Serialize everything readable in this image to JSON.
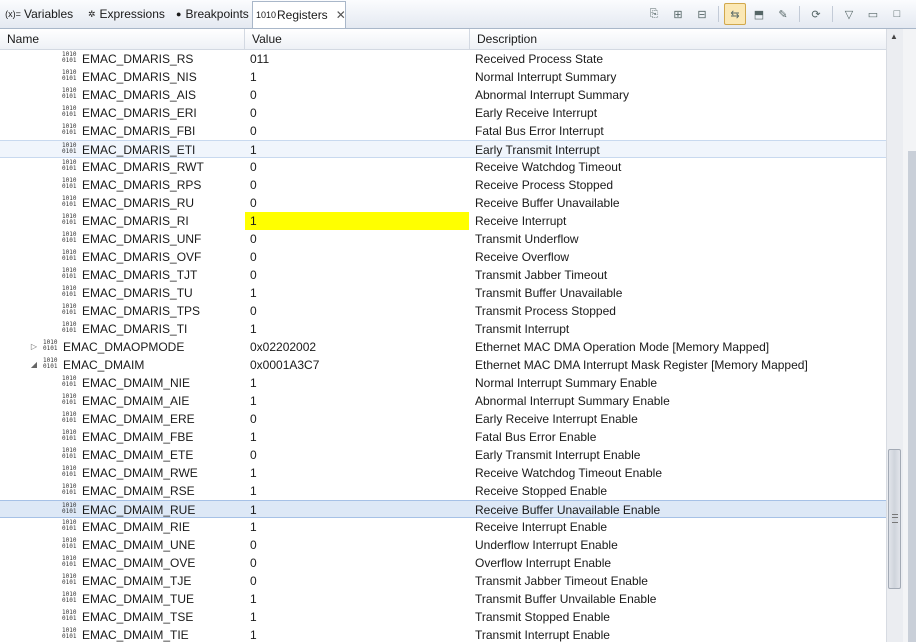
{
  "tabs": [
    {
      "label": "Variables",
      "icon": "variables-icon",
      "glyph": "(x)="
    },
    {
      "label": "Expressions",
      "icon": "expressions-icon",
      "glyph": "✲"
    },
    {
      "label": "Breakpoints",
      "icon": "breakpoints-icon",
      "glyph": "●"
    },
    {
      "label": "Registers",
      "icon": "registers-icon",
      "glyph": "1010",
      "close": "✕"
    }
  ],
  "toolbar": [
    {
      "name": "toolbar-import-icon",
      "glyph": "⎘"
    },
    {
      "name": "toolbar-expand-all-icon",
      "glyph": "⊞"
    },
    {
      "name": "toolbar-collapse-all-icon",
      "glyph": "⊟"
    },
    {
      "name": "toolbar-link-icon",
      "glyph": "⇆",
      "on": true
    },
    {
      "name": "toolbar-new-group-icon",
      "glyph": "⬒"
    },
    {
      "name": "toolbar-edit-group-icon",
      "glyph": "✎"
    },
    {
      "name": "toolbar-refresh-icon",
      "glyph": "⟳"
    },
    {
      "name": "view-menu-icon",
      "glyph": "▽"
    },
    {
      "name": "minimize-icon",
      "glyph": "▭"
    },
    {
      "name": "maximize-icon",
      "glyph": "□"
    }
  ],
  "columns": {
    "name": "Name",
    "value": "Value",
    "description": "Description"
  },
  "rows": [
    {
      "name": "EMAC_DMARIS_RS",
      "value": "011",
      "description": "Received Process State",
      "level": 2
    },
    {
      "name": "EMAC_DMARIS_NIS",
      "value": "1",
      "description": "Normal Interrupt Summary",
      "level": 2
    },
    {
      "name": "EMAC_DMARIS_AIS",
      "value": "0",
      "description": "Abnormal Interrupt Summary",
      "level": 2
    },
    {
      "name": "EMAC_DMARIS_ERI",
      "value": "0",
      "description": "Early Receive Interrupt",
      "level": 2
    },
    {
      "name": "EMAC_DMARIS_FBI",
      "value": "0",
      "description": "Fatal Bus Error Interrupt",
      "level": 2
    },
    {
      "name": "EMAC_DMARIS_ETI",
      "value": "1",
      "description": "Early Transmit Interrupt",
      "level": 2,
      "state": "hover"
    },
    {
      "name": "EMAC_DMARIS_RWT",
      "value": "0",
      "description": "Receive Watchdog Timeout",
      "level": 2
    },
    {
      "name": "EMAC_DMARIS_RPS",
      "value": "0",
      "description": "Receive Process Stopped",
      "level": 2
    },
    {
      "name": "EMAC_DMARIS_RU",
      "value": "0",
      "description": "Receive Buffer Unavailable",
      "level": 2
    },
    {
      "name": "EMAC_DMARIS_RI",
      "value": "1",
      "description": "Receive Interrupt",
      "level": 2,
      "changed": true
    },
    {
      "name": "EMAC_DMARIS_UNF",
      "value": "0",
      "description": "Transmit Underflow",
      "level": 2
    },
    {
      "name": "EMAC_DMARIS_OVF",
      "value": "0",
      "description": "Receive Overflow",
      "level": 2
    },
    {
      "name": "EMAC_DMARIS_TJT",
      "value": "0",
      "description": "Transmit Jabber Timeout",
      "level": 2
    },
    {
      "name": "EMAC_DMARIS_TU",
      "value": "1",
      "description": "Transmit Buffer Unavailable",
      "level": 2
    },
    {
      "name": "EMAC_DMARIS_TPS",
      "value": "0",
      "description": "Transmit Process Stopped",
      "level": 2
    },
    {
      "name": "EMAC_DMARIS_TI",
      "value": "1",
      "description": "Transmit Interrupt",
      "level": 2
    },
    {
      "name": "EMAC_DMAOPMODE",
      "value": "0x02202002",
      "description": "Ethernet MAC DMA Operation Mode [Memory Mapped]",
      "level": 1,
      "twisty": "▷"
    },
    {
      "name": "EMAC_DMAIM",
      "value": "0x0001A3C7",
      "description": "Ethernet MAC DMA Interrupt Mask Register [Memory Mapped]",
      "level": 1,
      "twisty": "◢"
    },
    {
      "name": "EMAC_DMAIM_NIE",
      "value": "1",
      "description": "Normal Interrupt Summary Enable",
      "level": 2
    },
    {
      "name": "EMAC_DMAIM_AIE",
      "value": "1",
      "description": "Abnormal Interrupt Summary Enable",
      "level": 2
    },
    {
      "name": "EMAC_DMAIM_ERE",
      "value": "0",
      "description": "Early Receive Interrupt Enable",
      "level": 2
    },
    {
      "name": "EMAC_DMAIM_FBE",
      "value": "1",
      "description": "Fatal Bus Error Enable",
      "level": 2
    },
    {
      "name": "EMAC_DMAIM_ETE",
      "value": "0",
      "description": "Early Transmit Interrupt Enable",
      "level": 2
    },
    {
      "name": "EMAC_DMAIM_RWE",
      "value": "1",
      "description": "Receive Watchdog Timeout Enable",
      "level": 2
    },
    {
      "name": "EMAC_DMAIM_RSE",
      "value": "1",
      "description": "Receive Stopped Enable",
      "level": 2
    },
    {
      "name": "EMAC_DMAIM_RUE",
      "value": "1",
      "description": "Receive Buffer Unavailable Enable",
      "level": 2,
      "state": "selected"
    },
    {
      "name": "EMAC_DMAIM_RIE",
      "value": "1",
      "description": "Receive Interrupt Enable",
      "level": 2
    },
    {
      "name": "EMAC_DMAIM_UNE",
      "value": "0",
      "description": "Underflow Interrupt Enable",
      "level": 2
    },
    {
      "name": "EMAC_DMAIM_OVE",
      "value": "0",
      "description": "Overflow Interrupt Enable",
      "level": 2
    },
    {
      "name": "EMAC_DMAIM_TJE",
      "value": "0",
      "description": "Transmit Jabber Timeout Enable",
      "level": 2
    },
    {
      "name": "EMAC_DMAIM_TUE",
      "value": "1",
      "description": "Transmit Buffer Unvailable Enable",
      "level": 2
    },
    {
      "name": "EMAC_DMAIM_TSE",
      "value": "1",
      "description": "Transmit Stopped Enable",
      "level": 2
    },
    {
      "name": "EMAC_DMAIM_TIE",
      "value": "1",
      "description": "Transmit Interrupt Enable",
      "level": 2
    }
  ],
  "colors": {
    "changed_value": "#ffff00",
    "selection": "#dde8f6"
  }
}
